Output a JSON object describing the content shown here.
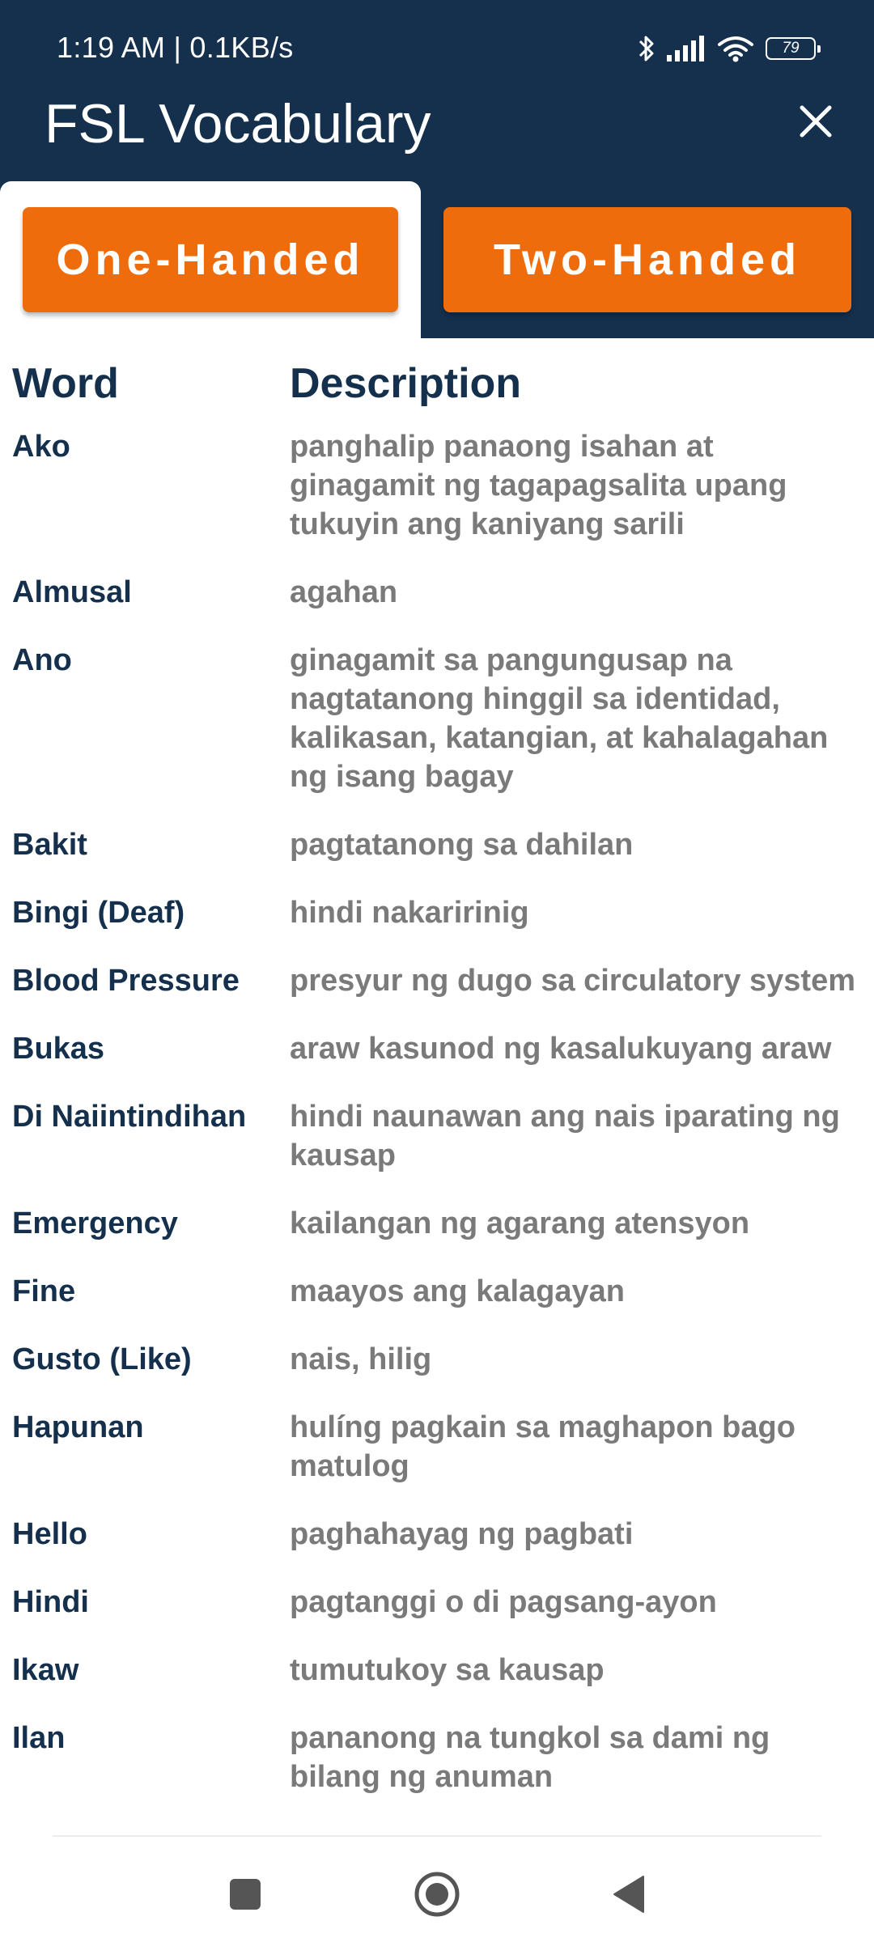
{
  "status_bar": {
    "time_speed": "1:19 AM | 0.1KB/s",
    "battery": "79",
    "icons": [
      "bluetooth-icon",
      "signal-icon",
      "wifi-icon",
      "battery-icon"
    ]
  },
  "app": {
    "title": "FSL Vocabulary",
    "close_icon": "close-icon"
  },
  "tabs": [
    {
      "label": "One-Handed",
      "selected": true
    },
    {
      "label": "Two-Handed",
      "selected": false
    }
  ],
  "table": {
    "headers": {
      "word": "Word",
      "description": "Description"
    },
    "rows": [
      {
        "word": "Ako",
        "description": "panghalip panaong isahan at ginagamit ng tagapagsalita upang tukuyin ang kaniyang sarili"
      },
      {
        "word": "Almusal",
        "description": "agahan"
      },
      {
        "word": "Ano",
        "description": "ginagamit sa pangungusap na nagtatanong hinggil sa identidad, kalikasan, katangian, at kahalagahan ng isang bagay"
      },
      {
        "word": "Bakit",
        "description": "pagtatanong sa dahilan"
      },
      {
        "word": "Bingi (Deaf)",
        "description": "hindi nakaririnig"
      },
      {
        "word": "Blood Pressure",
        "description": "presyur ng dugo sa circulatory system"
      },
      {
        "word": "Bukas",
        "description": "araw kasunod ng kasalukuyang araw"
      },
      {
        "word": "Di Naiintindihan",
        "description": "hindi naunawan ang nais iparating ng kausap"
      },
      {
        "word": "Emergency",
        "description": "kailangan ng agarang atensyon"
      },
      {
        "word": "Fine",
        "description": "maayos ang kalagayan"
      },
      {
        "word": "Gusto (Like)",
        "description": "nais, hilig"
      },
      {
        "word": "Hapunan",
        "description": "hulíng pagkain sa maghapon bago matulog"
      },
      {
        "word": "Hello",
        "description": "paghahayag ng pagbati"
      },
      {
        "word": "Hindi",
        "description": "pagtanggi o di pagsang-ayon"
      },
      {
        "word": "Ikaw",
        "description": "tumutukoy sa kausap"
      },
      {
        "word": "Ilan",
        "description": "pananong na tungkol sa dami ng bilang ng anuman"
      }
    ]
  },
  "nav": {
    "buttons": [
      "recents-square-icon",
      "home-circle-icon",
      "back-triangle-icon"
    ]
  },
  "colors": {
    "header_bg": "#15304d",
    "accent": "#ef6c0d",
    "word_text": "#15304d",
    "desc_text": "#7a7a7a"
  }
}
